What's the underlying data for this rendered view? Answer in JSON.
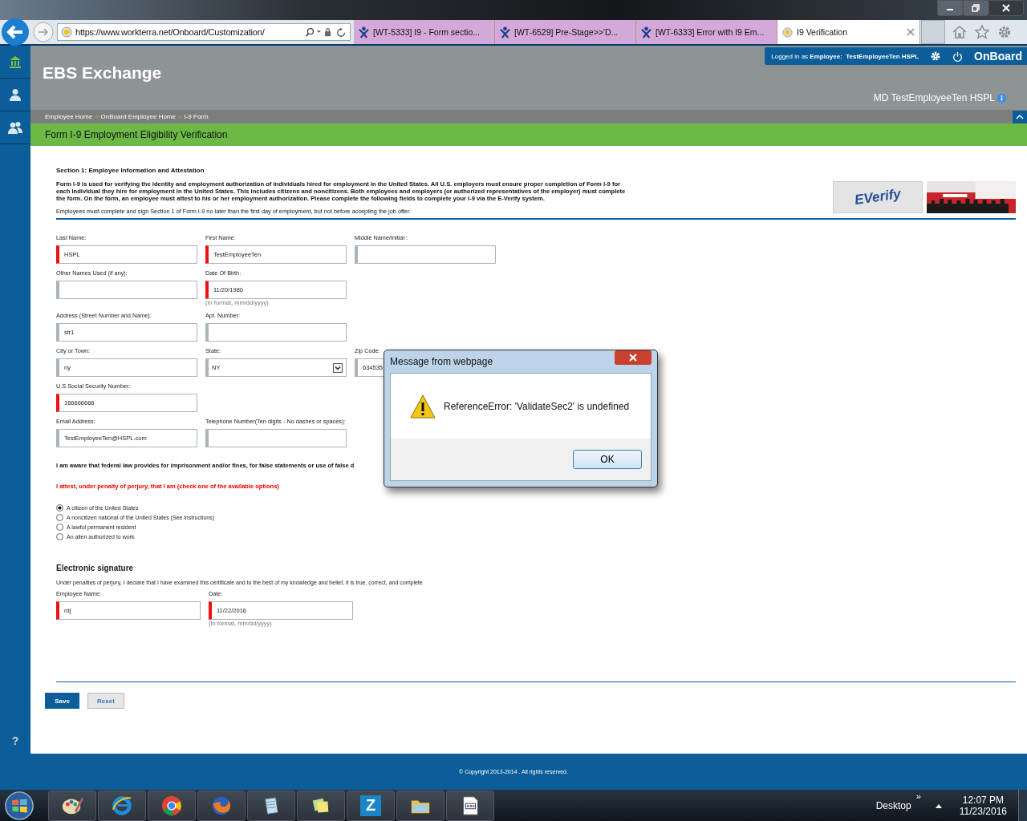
{
  "browser": {
    "address": "https://www.workterra.net/Onboard/Customization/",
    "tabs": [
      {
        "label": "[WT-5333] I9 - Form sectio...",
        "kind": "tracker",
        "selected": false
      },
      {
        "label": "[WT-6529] Pre-Stage>>'D...",
        "kind": "tracker",
        "selected": false
      },
      {
        "label": "[WT-6333] Error with I9 Em...",
        "kind": "tracker",
        "selected": false
      },
      {
        "label": "I9 Verification",
        "kind": "site",
        "selected": true
      }
    ]
  },
  "sidebar": {
    "items": [
      {
        "kind": "home",
        "selected": true
      },
      {
        "kind": "person",
        "selected": false
      },
      {
        "kind": "people",
        "selected": false
      }
    ],
    "help": "?"
  },
  "header": {
    "title": "EBS Exchange",
    "logged_in_prefix": "Logged in as",
    "role": "Employee:",
    "name": "TestEmployeeTen HSPL",
    "app": "OnBoard",
    "user": "MD TestEmployeeTen HSPL"
  },
  "breadcrumbs": [
    "Employee Home",
    "OnBoard Employee Home",
    "I-9 Form"
  ],
  "breadcrumb_separator": "»",
  "page_title": "Form I-9 Employment Eligibility Verification",
  "section": {
    "heading": "Section 1: Employee Information and Attestation",
    "intro": "Form I-9 is used for verifying the identity and employment authorization of individuals hired for employment in the United States. All U.S. employers must ensure proper completion of Form I-9 for each individual they hire for employment in the United States. This includes citizens and noncitizens. Both employees and employers (or authorized representatives of the employer) must complete the form. On the form, an employee must attest to his or her employment authorization. Please complete the following fields to complete your I-9 via the E-Verify system.",
    "note": "Employees must complete and sign Section 1 of Form I-9 no later than the first day of employment, but not before accepting the job offer.",
    "logo": "EVerify"
  },
  "field_rows": [
    [
      {
        "label": "Last Name:",
        "value": "HSPL",
        "required": true,
        "kind": "text"
      },
      {
        "label": "First Name:",
        "value": "TestEmployeeTen",
        "required": true,
        "kind": "text"
      },
      {
        "label": "Middle Name/Initial :",
        "required": false,
        "kind": "text"
      }
    ],
    [
      {
        "label": "Other Names Used (if any):",
        "required": false,
        "kind": "text"
      },
      {
        "label": "Date Of Birth:",
        "value": "11/20/1980",
        "required": true,
        "kind": "text",
        "hint": "(In format, mm/dd/yyyy)"
      }
    ],
    [
      {
        "label": "Address (Street Number and Name):",
        "value": "str1",
        "required": false,
        "kind": "text"
      },
      {
        "label": "Apt. Number:",
        "required": false,
        "kind": "text"
      }
    ],
    [
      {
        "label": "City or Town:",
        "value": "ny",
        "required": false,
        "kind": "text"
      },
      {
        "label": "State:",
        "value": "NY",
        "required": false,
        "kind": "select"
      },
      {
        "label": "Zip Code:",
        "value": "634535",
        "required": false,
        "kind": "text"
      }
    ],
    [
      {
        "label": "U.S.Social Security Number:",
        "value": "166666666",
        "required": true,
        "kind": "text"
      }
    ],
    [
      {
        "label": "Email Address:",
        "value": "TestEmployeeTen@HSPL.com",
        "required": false,
        "kind": "text"
      },
      {
        "label": "Telephone Number(Ten digits - No dashes or spaces):",
        "required": false,
        "kind": "text"
      }
    ]
  ],
  "aware": "I am aware that federal law provides for imprisonment and/or fines, for false statements or use of false d",
  "attest": "I attest, under penalty of perjury, that I am (check one of the available options)",
  "options": [
    {
      "label": "A citizen of the United States",
      "selected": true
    },
    {
      "label": "A noncitizen national of the United States (See instructions)",
      "selected": false
    },
    {
      "label": "A lawful permanent resident",
      "selected": false
    },
    {
      "label": "An alien authorized to work",
      "selected": false
    }
  ],
  "signature": {
    "heading": "Electronic signature",
    "statement": "Under penalties of perjury, I declare that I have examined this certificate and to the best of my knowledge and belief, it is true, correct, and complete",
    "fields": [
      {
        "label": "Employee Name:",
        "value": "rdj",
        "required": true,
        "kind": "text"
      },
      {
        "label": "Date:",
        "value": "11/22/2016",
        "required": true,
        "kind": "text",
        "hint": "(In format, mm/dd/yyyy)"
      }
    ]
  },
  "buttons": [
    {
      "label": "Save",
      "kind": "primary"
    },
    {
      "label": "Reset",
      "kind": "secondary"
    }
  ],
  "footer": "© Copyright 2013-2014 . All rights reserved.",
  "dialog": {
    "title": "Message from webpage",
    "message": "ReferenceError: 'ValidateSec2' is undefined",
    "button": "OK"
  },
  "taskbar": {
    "items": [
      {
        "kind": "paint"
      },
      {
        "kind": "ie"
      },
      {
        "kind": "chrome"
      },
      {
        "kind": "firefox"
      },
      {
        "kind": "notepad"
      },
      {
        "kind": "notes"
      },
      {
        "kind": "letter",
        "label": "Z"
      },
      {
        "kind": "folder"
      },
      {
        "kind": "document"
      }
    ],
    "desktop": "Desktop",
    "chevron": "»",
    "time": "12:07 PM",
    "date": "11/23/2016"
  }
}
